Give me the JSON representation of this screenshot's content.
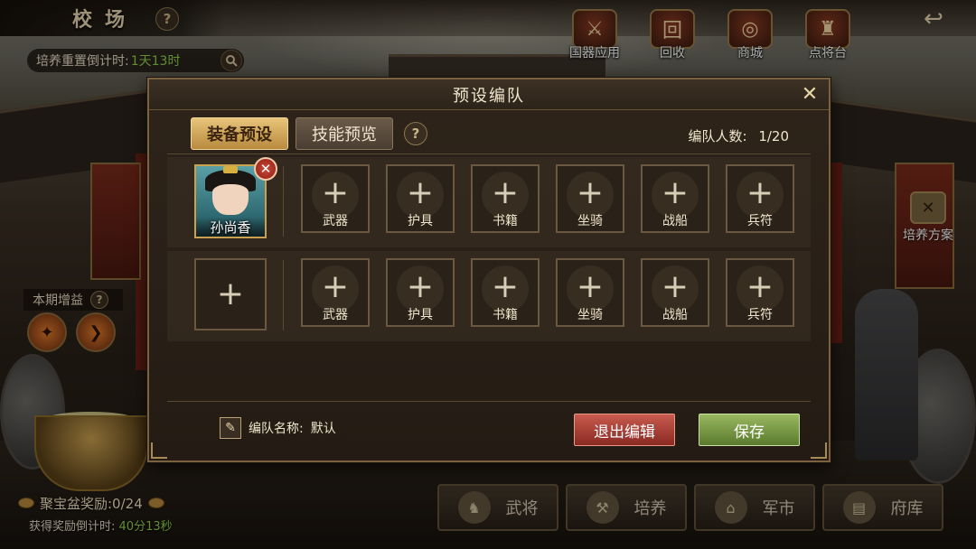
{
  "header": {
    "title": "校场",
    "reset_label": "培养重置倒计时:",
    "reset_value": "1天13时"
  },
  "top_actions": [
    {
      "label": "国器应用",
      "icon": "crossed-weapons-icon"
    },
    {
      "label": "回收",
      "icon": "recycle-icon"
    },
    {
      "label": "商城",
      "icon": "shop-icon"
    },
    {
      "label": "点将台",
      "icon": "general-helmet-icon"
    }
  ],
  "left_panel": {
    "bonus_label": "本期增益",
    "pot_reward": "聚宝盆奖励:0/24",
    "pot_timer_label": "获得奖励倒计时:",
    "pot_timer_value": "40分13秒"
  },
  "right_panel": {
    "plan_label": "培养方案"
  },
  "bottom_nav": [
    {
      "label": "武将",
      "icon": "general-icon"
    },
    {
      "label": "培养",
      "icon": "training-icon"
    },
    {
      "label": "军市",
      "icon": "market-icon"
    },
    {
      "label": "府库",
      "icon": "treasury-icon"
    }
  ],
  "modal": {
    "title": "预设编队",
    "tabs": [
      {
        "label": "装备预设",
        "active": true
      },
      {
        "label": "技能预览",
        "active": false
      }
    ],
    "team_count_label": "编队人数:",
    "team_count_value": "1/20",
    "rows": [
      {
        "hero": {
          "name": "孙尚香",
          "filled": true
        },
        "slots": [
          "武器",
          "护具",
          "书籍",
          "坐骑",
          "战船",
          "兵符"
        ]
      },
      {
        "hero": {
          "name": "",
          "filled": false
        },
        "slots": [
          "武器",
          "护具",
          "书籍",
          "坐骑",
          "战船",
          "兵符"
        ]
      }
    ],
    "team_name_label": "编队名称:",
    "team_name_value": "默认",
    "exit_button": "退出编辑",
    "save_button": "保存"
  },
  "colors": {
    "accent_gold": "#e8c47a",
    "exit_red": "#c85a4e",
    "save_green": "#9ab860",
    "timer_green": "#8fd14a"
  }
}
